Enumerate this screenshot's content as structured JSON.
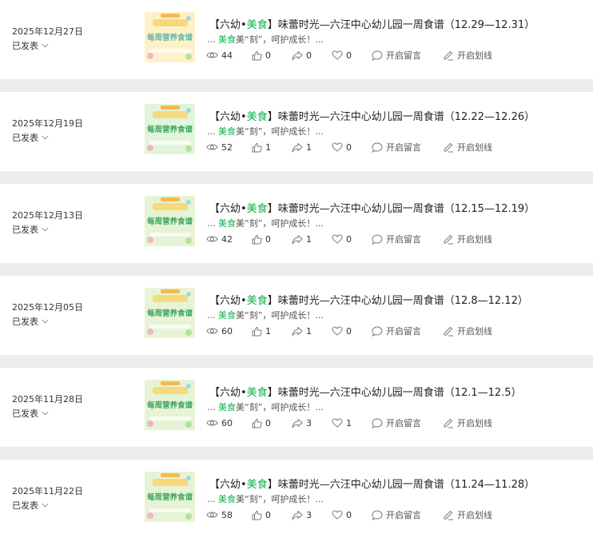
{
  "articles": [
    {
      "date": "2025年12月27日",
      "status": "已发表",
      "title_prefix": "【六幼•",
      "title_highlight": "美食",
      "title_suffix": "】味蕾时光—六汪中心幼儿园一周食谱（12.29—12.31）",
      "digest_prefix": "... ",
      "digest_highlight": "美食",
      "digest_suffix": "美“刻”，呵护成长！...",
      "views": "44",
      "likes": "0",
      "shares": "0",
      "favorites": "0",
      "comment_label": "开启留言",
      "underline_label": "开启划线",
      "thumb_text": "每周营养食谱",
      "thumb_bg": "#fdf1c9",
      "thumb_text_color": "#63b9a6"
    },
    {
      "date": "2025年12月19日",
      "status": "已发表",
      "title_prefix": "【六幼•",
      "title_highlight": "美食",
      "title_suffix": "】味蕾时光—六汪中心幼儿园一周食谱（12.22—12.26）",
      "digest_prefix": "... ",
      "digest_highlight": "美食",
      "digest_suffix": "美“刻”，呵护成长！...",
      "views": "52",
      "likes": "1",
      "shares": "1",
      "favorites": "0",
      "comment_label": "开启留言",
      "underline_label": "开启划线",
      "thumb_text": "每周营养食谱",
      "thumb_bg": "#e2f5dc",
      "thumb_text_color": "#3aa861"
    },
    {
      "date": "2025年12月13日",
      "status": "已发表",
      "title_prefix": "【六幼•",
      "title_highlight": "美食",
      "title_suffix": "】味蕾时光—六汪中心幼儿园一周食谱（12.15—12.19）",
      "digest_prefix": "... ",
      "digest_highlight": "美食",
      "digest_suffix": "美“刻”，呵护成长！...",
      "views": "42",
      "likes": "0",
      "shares": "1",
      "favorites": "0",
      "comment_label": "开启留言",
      "underline_label": "开启划线",
      "thumb_text": "每周营养食谱",
      "thumb_bg": "#e6f3d4",
      "thumb_text_color": "#3aa861"
    },
    {
      "date": "2025年12月05日",
      "status": "已发表",
      "title_prefix": "【六幼•",
      "title_highlight": "美食",
      "title_suffix": "】味蕾时光—六汪中心幼儿园一周食谱（12.8—12.12）",
      "digest_prefix": "... ",
      "digest_highlight": "美食",
      "digest_suffix": "美“刻”，呵护成长！...",
      "views": "60",
      "likes": "1",
      "shares": "1",
      "favorites": "0",
      "comment_label": "开启留言",
      "underline_label": "开启划线",
      "thumb_text": "每周营养食谱",
      "thumb_bg": "#e8f4d8",
      "thumb_text_color": "#3aa861"
    },
    {
      "date": "2025年11月28日",
      "status": "已发表",
      "title_prefix": "【六幼•",
      "title_highlight": "美食",
      "title_suffix": "】味蕾时光—六汪中心幼儿园一周食谱（12.1—12.5）",
      "digest_prefix": "... ",
      "digest_highlight": "美食",
      "digest_suffix": "美“刻”，呵护成长！...",
      "views": "60",
      "likes": "0",
      "shares": "3",
      "favorites": "1",
      "comment_label": "开启留言",
      "underline_label": "开启划线",
      "thumb_text": "每周营养食谱",
      "thumb_bg": "#e6f3d4",
      "thumb_text_color": "#3aa861"
    },
    {
      "date": "2025年11月22日",
      "status": "已发表",
      "title_prefix": "【六幼•",
      "title_highlight": "美食",
      "title_suffix": "】味蕾时光—六汪中心幼儿园一周食谱（11.24—11.28）",
      "digest_prefix": "... ",
      "digest_highlight": "美食",
      "digest_suffix": "美“刻”，呵护成长！...",
      "views": "58",
      "likes": "0",
      "shares": "3",
      "favorites": "0",
      "comment_label": "开启留言",
      "underline_label": "开启划线",
      "thumb_text": "每周营养食谱",
      "thumb_bg": "#e6f3d4",
      "thumb_text_color": "#3aa861"
    }
  ],
  "colors": {
    "highlight": "#07b44a",
    "page_bg": "#ececec",
    "card_bg": "#ffffff",
    "icon_gray": "#7a7a7a"
  },
  "icons": {
    "views": "eye-icon",
    "likes": "thumbs-up-icon",
    "shares": "share-icon",
    "favorites": "heart-icon",
    "comment": "comment-bubble-icon",
    "underline": "pen-icon",
    "status": "chevron-down-icon"
  }
}
